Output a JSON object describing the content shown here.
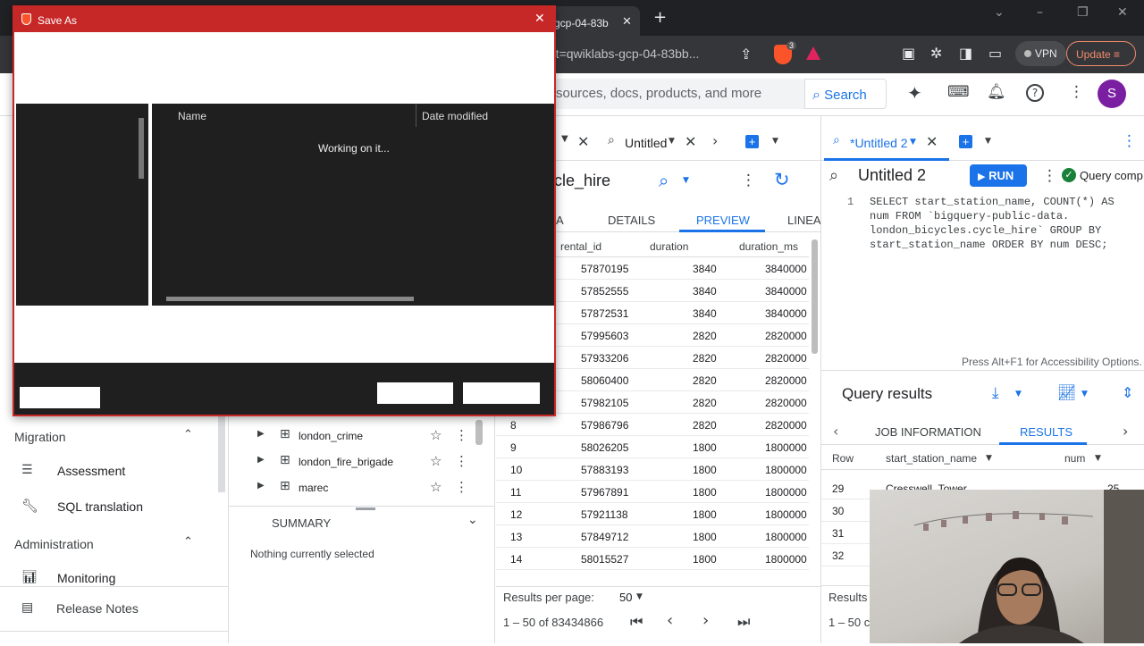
{
  "browser": {
    "tab_title": "gcp-04-83b",
    "url": "oject=qwiklabs-gcp-04-83bb...",
    "brave_count": "3",
    "vpn": "VPN",
    "update": "Update"
  },
  "header": {
    "search_placeholder": "sources, docs, products, and more",
    "search_button": "Search",
    "avatar": "S"
  },
  "tabs": {
    "untitled": "Untitled",
    "untitled2": "*Untitled 2"
  },
  "table_panel": {
    "title": "cle_hire",
    "tabs": [
      "A",
      "DETAILS",
      "PREVIEW",
      "LINEA"
    ],
    "columns": [
      "rental_id",
      "duration",
      "duration_ms"
    ],
    "rows": [
      {
        "n": "",
        "rental_id": "57870195",
        "duration": "3840",
        "duration_ms": "3840000"
      },
      {
        "n": "",
        "rental_id": "57852555",
        "duration": "3840",
        "duration_ms": "3840000"
      },
      {
        "n": "",
        "rental_id": "57872531",
        "duration": "3840",
        "duration_ms": "3840000"
      },
      {
        "n": "",
        "rental_id": "57995603",
        "duration": "2820",
        "duration_ms": "2820000"
      },
      {
        "n": "",
        "rental_id": "57933206",
        "duration": "2820",
        "duration_ms": "2820000"
      },
      {
        "n": "",
        "rental_id": "58060400",
        "duration": "2820",
        "duration_ms": "2820000"
      },
      {
        "n": "",
        "rental_id": "57982105",
        "duration": "2820",
        "duration_ms": "2820000"
      },
      {
        "n": "8",
        "rental_id": "57986796",
        "duration": "2820",
        "duration_ms": "2820000"
      },
      {
        "n": "9",
        "rental_id": "58026205",
        "duration": "1800",
        "duration_ms": "1800000"
      },
      {
        "n": "10",
        "rental_id": "57883193",
        "duration": "1800",
        "duration_ms": "1800000"
      },
      {
        "n": "11",
        "rental_id": "57967891",
        "duration": "1800",
        "duration_ms": "1800000"
      },
      {
        "n": "12",
        "rental_id": "57921138",
        "duration": "1800",
        "duration_ms": "1800000"
      },
      {
        "n": "13",
        "rental_id": "57849712",
        "duration": "1800",
        "duration_ms": "1800000"
      },
      {
        "n": "14",
        "rental_id": "58015527",
        "duration": "1800",
        "duration_ms": "1800000"
      }
    ],
    "results_per_page_label": "Results per page:",
    "results_per_page": "50",
    "range": "1 – 50 of 83434866"
  },
  "editor": {
    "title": "Untitled 2",
    "run": "RUN",
    "status": "Query comp",
    "line_no": "1",
    "code_lines": [
      "SELECT start_station_name, COUNT(*) AS",
      "num FROM `bigquery-public-data.",
      "london_bicycles.cycle_hire` GROUP BY",
      "start_station_name ORDER BY num DESC;"
    ],
    "accessibility": "Press Alt+F1 for Accessibility Options."
  },
  "results": {
    "title": "Query results",
    "tabs": [
      "JOB INFORMATION",
      "RESULTS"
    ],
    "columns": [
      "Row",
      "start_station_name",
      "num"
    ],
    "rows": [
      {
        "n": "29",
        "name": "Cresswell_Tower",
        "num": "25"
      },
      {
        "n": "30",
        "name": "",
        "num": ""
      },
      {
        "n": "31",
        "name": "",
        "num": ""
      },
      {
        "n": "32",
        "name": "",
        "num": ""
      }
    ],
    "footer": "Results",
    "footer_range": "1 – 50 c"
  },
  "sidebar": {
    "migration": "Migration",
    "assessment": "Assessment",
    "sql_translation": "SQL translation",
    "administration": "Administration",
    "monitoring": "Monitoring",
    "release_notes": "Release Notes"
  },
  "explorer": {
    "items": [
      "london_crime",
      "london_fire_brigade",
      "marec"
    ],
    "summary": "SUMMARY",
    "nothing_selected": "Nothing currently selected"
  },
  "dialog": {
    "title": "Save As",
    "col_name": "Name",
    "col_date": "Date modified",
    "working": "Working on it..."
  }
}
